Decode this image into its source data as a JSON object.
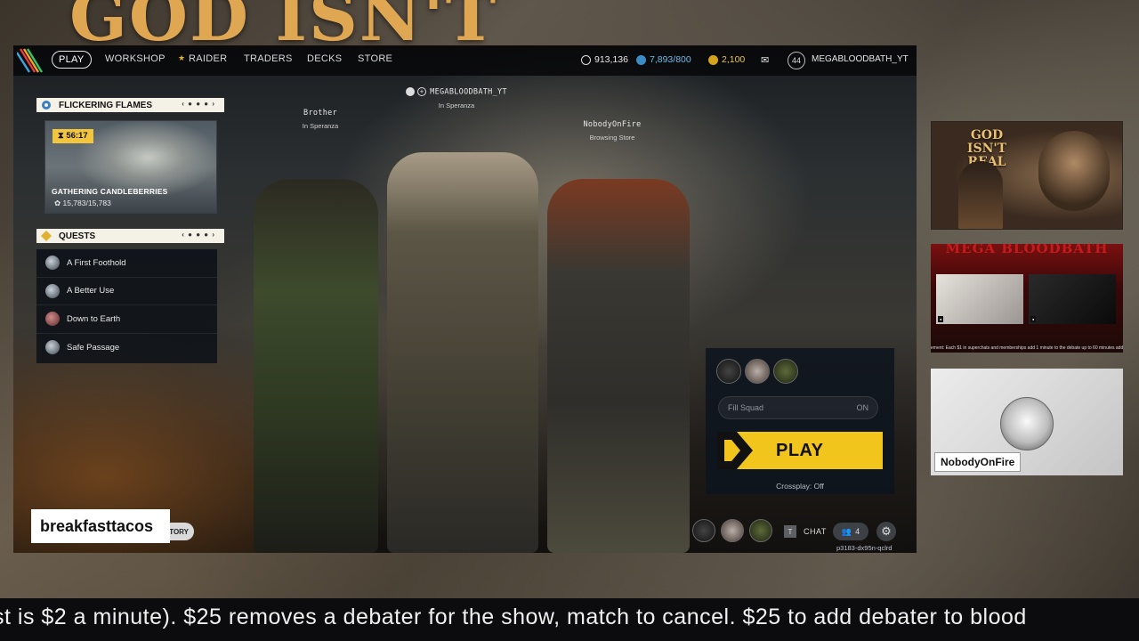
{
  "overlay": {
    "background_title": "GOD ISN'T",
    "streamer_name": "breakfasttacos",
    "ticker_text": "st is $2 a minute). $25 removes a debater for the show, match to cancel. $25 to add debater to blood"
  },
  "nav": {
    "items": [
      {
        "label": "PLAY",
        "active": true
      },
      {
        "label": "WORKSHOP"
      },
      {
        "label": "RAIDER",
        "icon": "star-icon"
      },
      {
        "label": "TRADERS"
      },
      {
        "label": "DECKS"
      },
      {
        "label": "STORE"
      }
    ]
  },
  "currency": {
    "coins": "913,136",
    "storage": "7,893/800",
    "tokens": "2,100",
    "level": "44",
    "username": "MEGABLOODBATH_YT"
  },
  "event": {
    "header": "FLICKERING FLAMES",
    "timer": "56:17",
    "label": "GATHERING CANDLEBERRIES",
    "progress": "15,783/15,783"
  },
  "quests": {
    "header": "QUESTS",
    "items": [
      {
        "label": "A First Foothold"
      },
      {
        "label": "A Better Use"
      },
      {
        "label": "Down to Earth"
      },
      {
        "label": "Safe Passage"
      }
    ]
  },
  "players": [
    {
      "name": "Brother",
      "status": "In Speranza"
    },
    {
      "name": "MEGABLOODBATH_YT",
      "status": "In Speranza"
    },
    {
      "name": "NobodyOnFire",
      "status": "Browsing Store"
    }
  ],
  "play_panel": {
    "fill_squad_label": "Fill Squad",
    "fill_squad_value": "ON",
    "play_label": "PLAY",
    "crossplay": "Crossplay: Off"
  },
  "bottom_bar": {
    "history_label": "TORY",
    "chat_key": "T",
    "chat_label": "CHAT",
    "squad_count": "4",
    "session_id": "p3183-dx95n-qclrd"
  },
  "cams": {
    "cam1_title": "GOD ISN'T REAL",
    "cam2_title": "MEGA BLOODBATH",
    "cam2_ticker": "ement: Each $1 in superchats and memberships add 1 minute to the debate up to 60 minutes add",
    "cam3_name": "NobodyOnFire"
  },
  "colors": {
    "accent_yellow": "#f2c51d",
    "title_gold": "#e0a752",
    "panel_head": "#f4f1e6"
  }
}
